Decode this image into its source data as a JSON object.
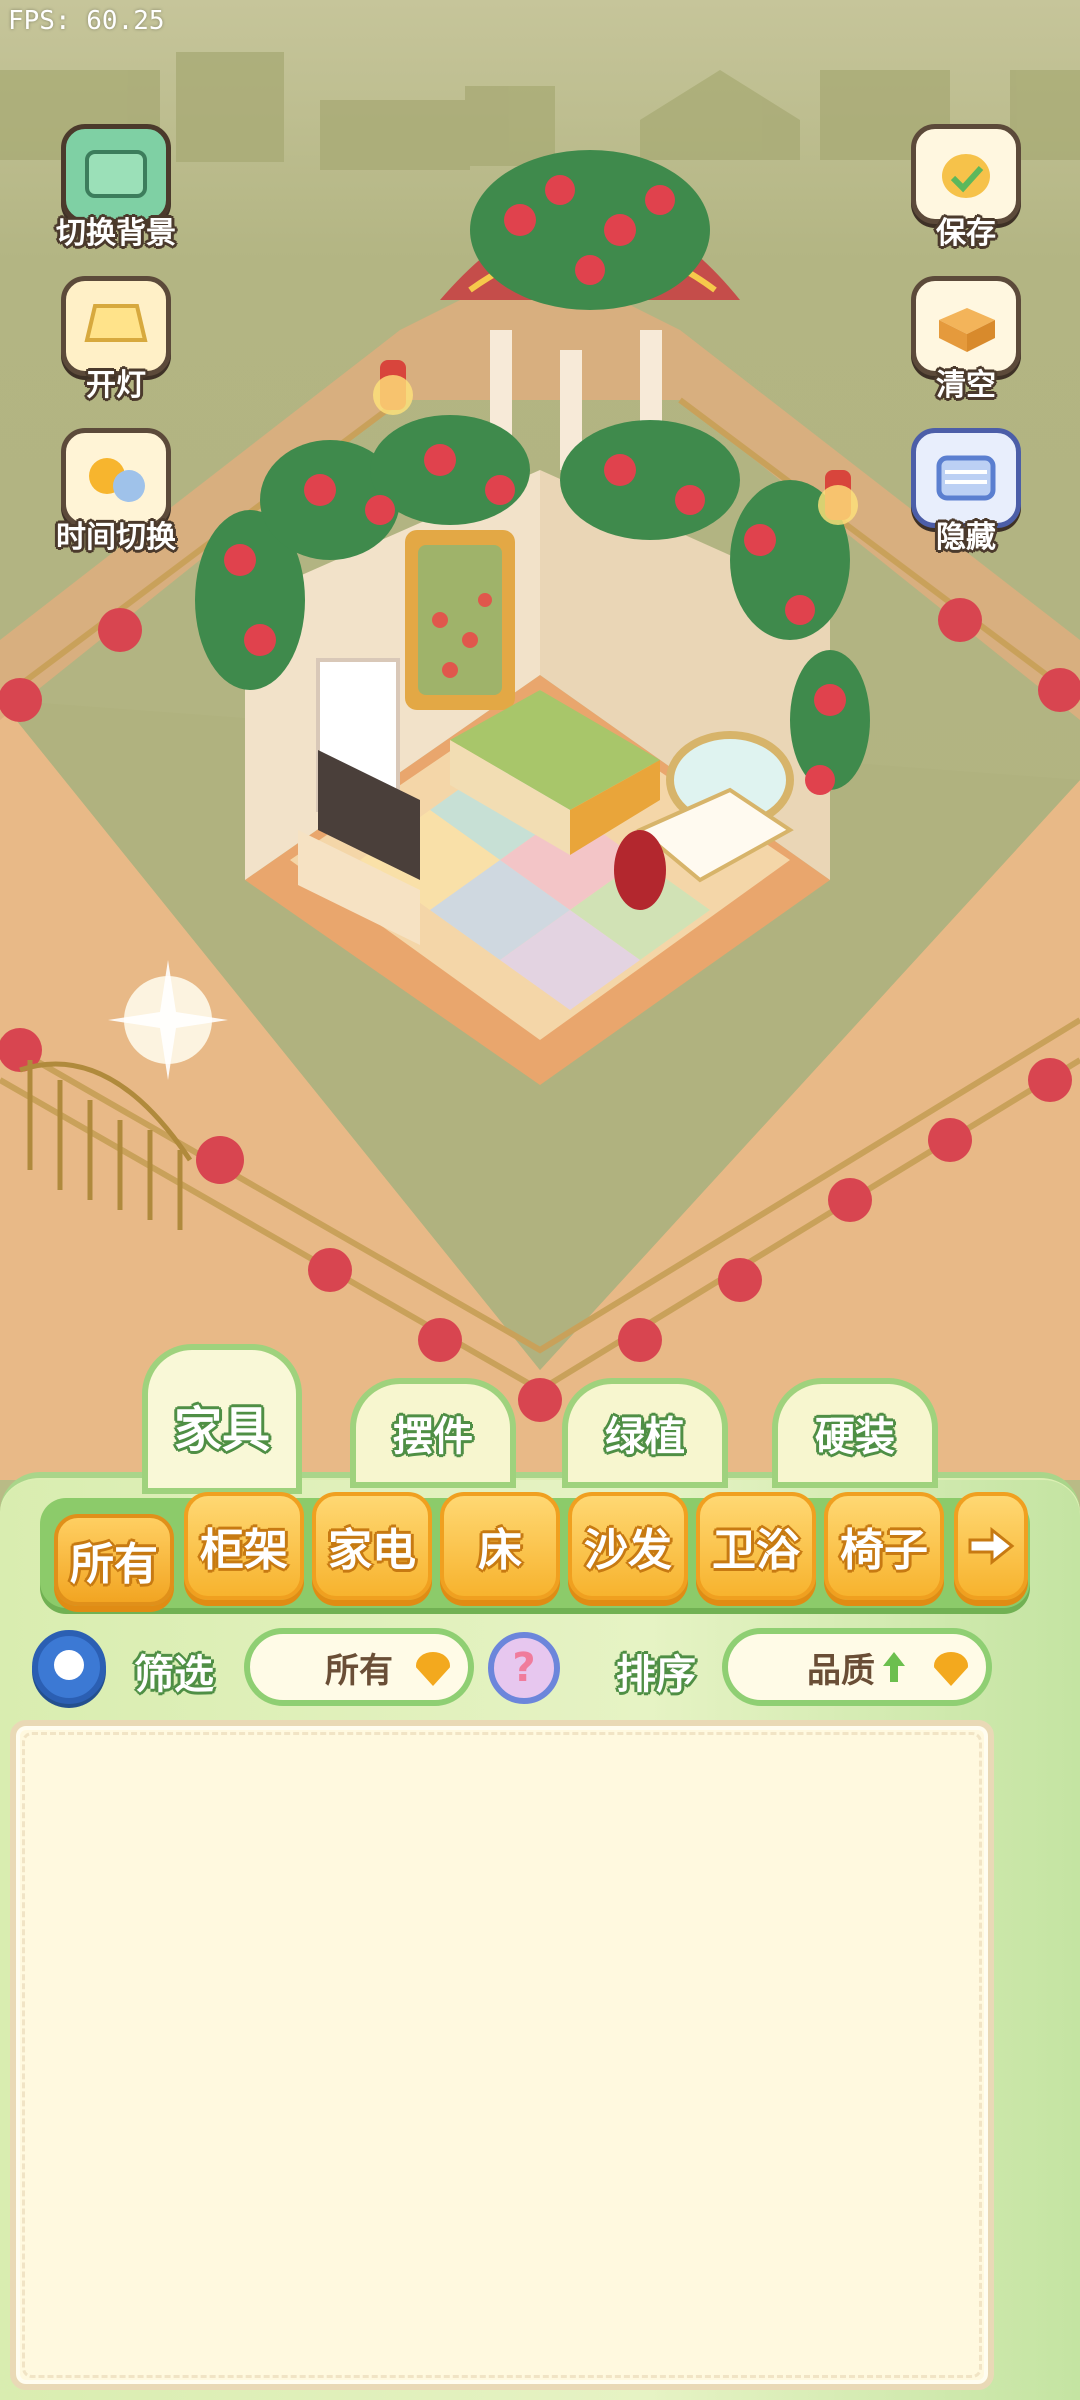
{
  "fps": "FPS: 60.25",
  "left_buttons": [
    {
      "label": "切换背景",
      "icon": "scroll-icon"
    },
    {
      "label": "开灯",
      "icon": "lamp-icon"
    },
    {
      "label": "时间切换",
      "icon": "sun-moon-icon"
    }
  ],
  "right_buttons": [
    {
      "label": "保存",
      "icon": "chick-save-icon"
    },
    {
      "label": "清空",
      "icon": "box-clear-icon"
    },
    {
      "label": "隐藏",
      "icon": "hide-frame-icon"
    }
  ],
  "tabs": [
    {
      "label": "家具",
      "active": true
    },
    {
      "label": "摆件",
      "active": false
    },
    {
      "label": "绿植",
      "active": false
    },
    {
      "label": "硬装",
      "active": false
    }
  ],
  "categories": [
    {
      "label": "所有",
      "active": true
    },
    {
      "label": "柜架"
    },
    {
      "label": "家电"
    },
    {
      "label": "床"
    },
    {
      "label": "沙发"
    },
    {
      "label": "卫浴"
    },
    {
      "label": "椅子"
    }
  ],
  "filter": {
    "label": "筛选",
    "value": "所有"
  },
  "sort": {
    "label": "排序",
    "value": "品质",
    "direction_icon": "arrow-up-icon"
  },
  "help_icon": "?",
  "colors": {
    "panel_green": "#8ccb6a",
    "category_orange": "#f7b32e",
    "list_bg": "#fff9df"
  }
}
